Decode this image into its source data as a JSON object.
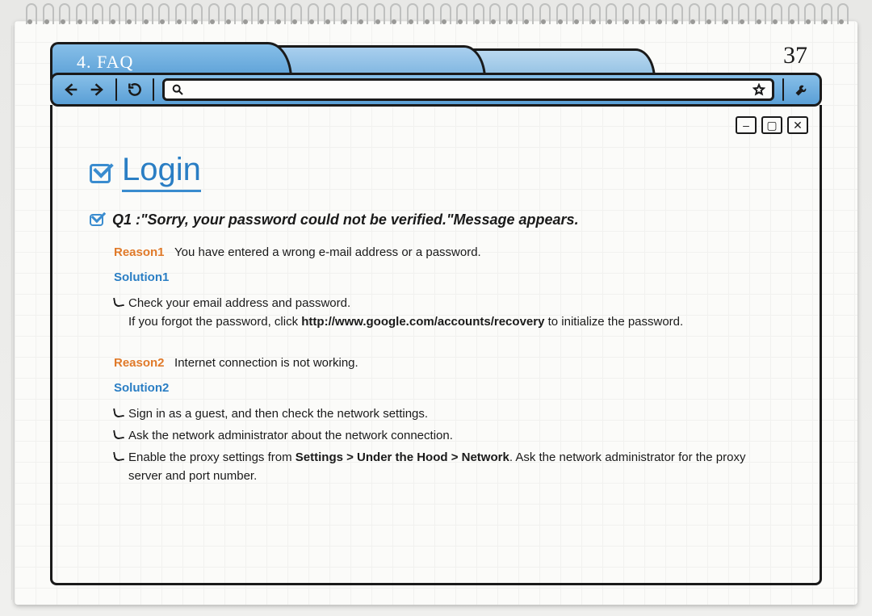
{
  "chapter_tab": "4. FAQ",
  "page_number": "37",
  "page_title": "Login",
  "question": "Q1 :\"Sorry, your password could not be verified.\"Message appears.",
  "reason1_label": "Reason1",
  "reason1_text": "You have entered a wrong e-mail address or a password.",
  "solution1_label": "Solution1",
  "sol1_bullet1": "Check your email address and password.",
  "sol1_line2a": "If you forgot the password, click ",
  "sol1_line2b": "http://www.google.com/accounts/recovery",
  "sol1_line2c": " to initialize the password.",
  "reason2_label": "Reason2",
  "reason2_text": "Internet connection is not working.",
  "solution2_label": "Solution2",
  "sol2_bullet1": "Sign in as a guest, and then check the network settings.",
  "sol2_bullet2": "Ask the network administrator about the network connection.",
  "sol2_b3a": "Enable the proxy settings from ",
  "sol2_b3b": "Settings > Under the Hood > Network",
  "sol2_b3c": ". Ask the network administrator for the proxy server and port number.",
  "win": {
    "min": "–",
    "max": "▢",
    "close": "✕"
  }
}
